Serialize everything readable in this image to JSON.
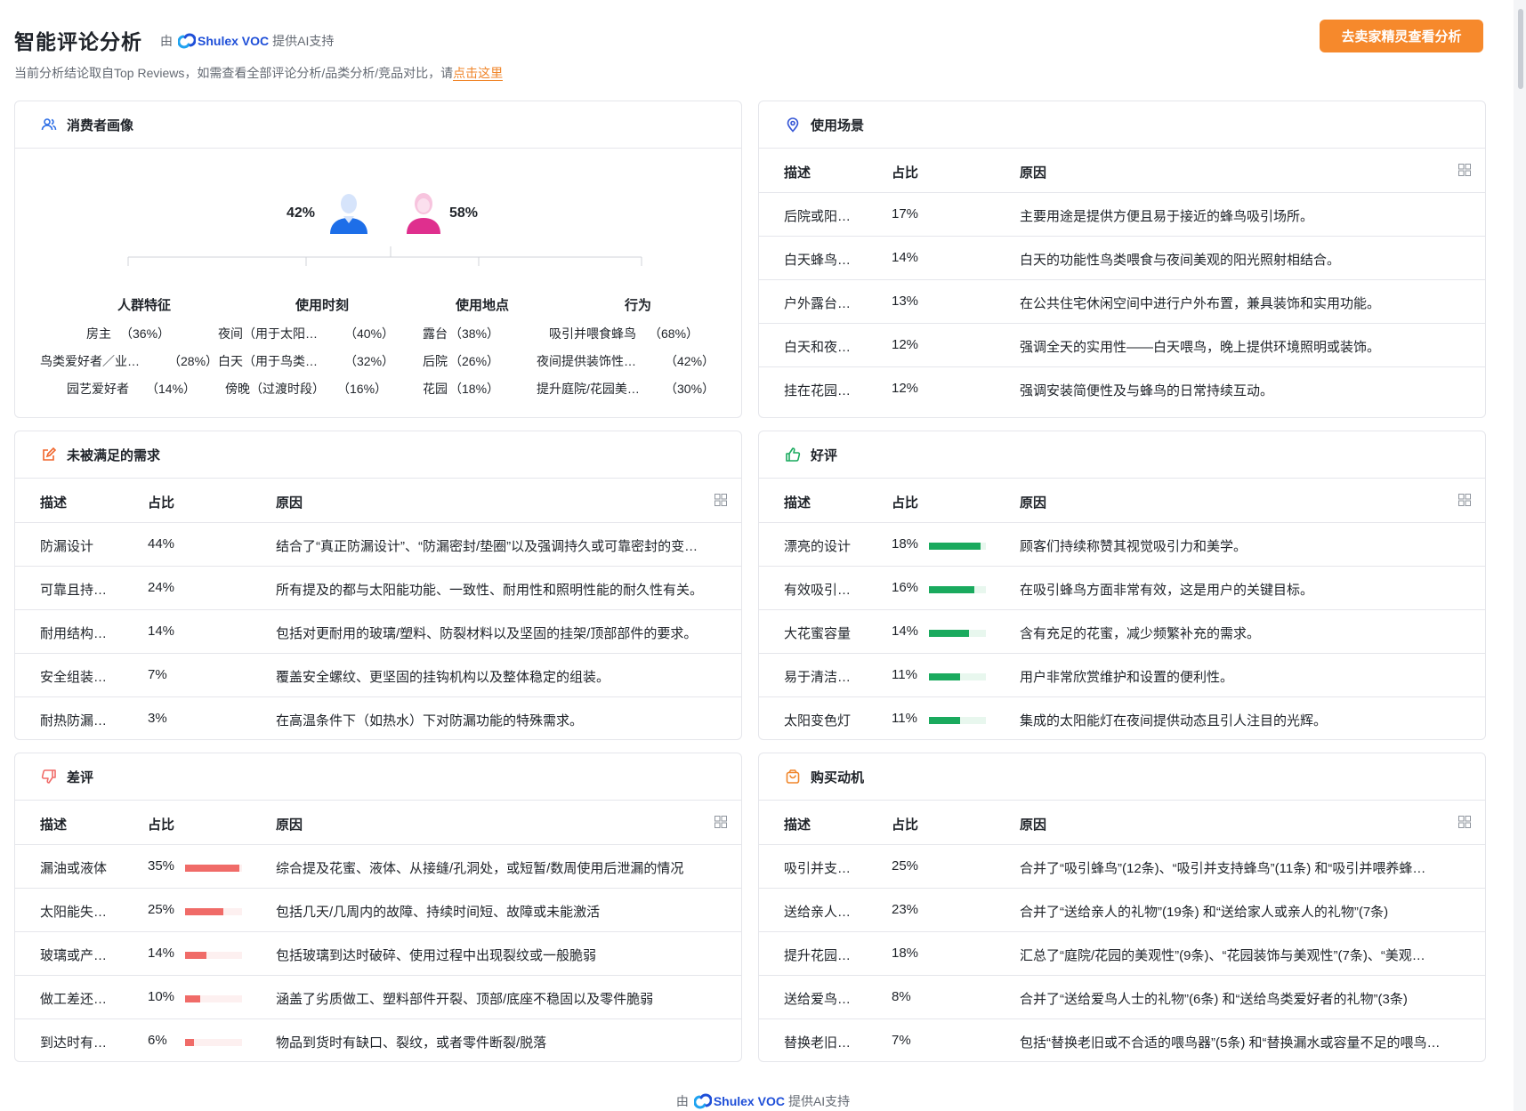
{
  "header": {
    "title": "智能评论分析",
    "powered_prefix": "由",
    "brand": "Shulex VOC",
    "powered_suffix": "提供AI支持",
    "note": "当前分析结论取自Top Reviews，如需查看全部评论分析/品类分析/竞品对比，请",
    "note_link": "点击这里",
    "cta": "去卖家精灵查看分析"
  },
  "persona": {
    "title": "消费者画像",
    "male_pct": "42%",
    "female_pct": "58%",
    "categories": [
      {
        "title": "人群特征",
        "items": [
          {
            "label": "房主",
            "pct": "（36%）"
          },
          {
            "label": "鸟类爱好者／业…",
            "pct": "（28%）"
          },
          {
            "label": "园艺爱好者",
            "pct": "（14%）"
          }
        ]
      },
      {
        "title": "使用时刻",
        "items": [
          {
            "label": "夜间（用于太阳…",
            "pct": "（40%）"
          },
          {
            "label": "白天（用于鸟类…",
            "pct": "（32%）"
          },
          {
            "label": "傍晚（过渡时段）",
            "pct": "（16%）"
          }
        ]
      },
      {
        "title": "使用地点",
        "items": [
          {
            "label": "露台",
            "pct": "（38%）"
          },
          {
            "label": "后院",
            "pct": "（26%）"
          },
          {
            "label": "花园",
            "pct": "（18%）"
          }
        ]
      },
      {
        "title": "行为",
        "items": [
          {
            "label": "吸引并喂食蜂鸟",
            "pct": "（68%）"
          },
          {
            "label": "夜间提供装饰性…",
            "pct": "（42%）"
          },
          {
            "label": "提升庭院/花园美…",
            "pct": "（30%）"
          }
        ]
      }
    ]
  },
  "columns": {
    "desc": "描述",
    "pct": "占比",
    "reason": "原因"
  },
  "scenes": {
    "title": "使用场景",
    "rows": [
      {
        "desc": "后院或阳…",
        "pct": "17%",
        "reason": "主要用途是提供方便且易于接近的蜂鸟吸引场所。"
      },
      {
        "desc": "白天蜂鸟…",
        "pct": "14%",
        "reason": "白天的功能性鸟类喂食与夜间美观的阳光照射相结合。"
      },
      {
        "desc": "户外露台…",
        "pct": "13%",
        "reason": "在公共住宅休闲空间中进行户外布置，兼具装饰和实用功能。"
      },
      {
        "desc": "白天和夜…",
        "pct": "12%",
        "reason": "强调全天的实用性——白天喂鸟，晚上提供环境照明或装饰。"
      },
      {
        "desc": "挂在花园…",
        "pct": "12%",
        "reason": "强调安装简便性及与蜂鸟的日常持续互动。"
      }
    ]
  },
  "unmet": {
    "title": "未被满足的需求",
    "rows": [
      {
        "desc": "防漏设计",
        "pct": "44%",
        "reason": "结合了“真正防漏设计”、“防漏密封/垫圈”以及强调持久或可靠密封的变…"
      },
      {
        "desc": "可靠且持…",
        "pct": "24%",
        "reason": "所有提及的都与太阳能功能、一致性、耐用性和照明性能的耐久性有关。"
      },
      {
        "desc": "耐用结构…",
        "pct": "14%",
        "reason": "包括对更耐用的玻璃/塑料、防裂材料以及坚固的挂架/顶部部件的要求。"
      },
      {
        "desc": "安全组装…",
        "pct": "7%",
        "reason": "覆盖安全螺纹、更坚固的挂钩机构以及整体稳定的组装。"
      },
      {
        "desc": "耐热防漏…",
        "pct": "3%",
        "reason": "在高温条件下（如热水）下对防漏功能的特殊需求。"
      }
    ]
  },
  "positive": {
    "title": "好评",
    "bar_color": "#1aaa5e",
    "rows": [
      {
        "desc": "漂亮的设计",
        "pct": "18%",
        "value": 0.18,
        "reason": "顾客们持续称赞其视觉吸引力和美学。"
      },
      {
        "desc": "有效吸引…",
        "pct": "16%",
        "value": 0.16,
        "reason": "在吸引蜂鸟方面非常有效，这是用户的关键目标。"
      },
      {
        "desc": "大花蜜容量",
        "pct": "14%",
        "value": 0.14,
        "reason": "含有充足的花蜜，减少频繁补充的需求。"
      },
      {
        "desc": "易于清洁…",
        "pct": "11%",
        "value": 0.11,
        "reason": "用户非常欣赏维护和设置的便利性。"
      },
      {
        "desc": "太阳变色灯",
        "pct": "11%",
        "value": 0.11,
        "reason": "集成的太阳能灯在夜间提供动态且引人注目的光辉。"
      }
    ]
  },
  "negative": {
    "title": "差评",
    "bar_color": "#f06b68",
    "rows": [
      {
        "desc": "漏油或液体",
        "pct": "35%",
        "value": 0.35,
        "reason": "综合提及花蜜、液体、从接缝/孔洞处，或短暂/数周使用后泄漏的情况"
      },
      {
        "desc": "太阳能失…",
        "pct": "25%",
        "value": 0.25,
        "reason": "包括几天/几周内的故障、持续时间短、故障或未能激活"
      },
      {
        "desc": "玻璃或产…",
        "pct": "14%",
        "value": 0.14,
        "reason": "包括玻璃到达时破碎、使用过程中出现裂纹或一般脆弱"
      },
      {
        "desc": "做工差还…",
        "pct": "10%",
        "value": 0.1,
        "reason": "涵盖了劣质做工、塑料部件开裂、顶部/底座不稳固以及零件脆弱"
      },
      {
        "desc": "到达时有…",
        "pct": "6%",
        "value": 0.06,
        "reason": "物品到货时有缺口、裂纹，或者零件断裂/脱落"
      }
    ]
  },
  "motive": {
    "title": "购买动机",
    "rows": [
      {
        "desc": "吸引并支…",
        "pct": "25%",
        "reason": "合并了“吸引蜂鸟”(12条)、“吸引并支持蜂鸟”(11条) 和“吸引并喂养蜂…"
      },
      {
        "desc": "送给亲人…",
        "pct": "23%",
        "reason": "合并了“送给亲人的礼物”(19条) 和“送给家人或亲人的礼物”(7条)"
      },
      {
        "desc": "提升花园…",
        "pct": "18%",
        "reason": "汇总了“庭院/花园的美观性”(9条)、“花园装饰与美观性”(7条)、“美观…"
      },
      {
        "desc": "送给爱鸟…",
        "pct": "8%",
        "reason": "合并了“送给爱鸟人士的礼物”(6条) 和“送给鸟类爱好者的礼物”(3条)"
      },
      {
        "desc": "替换老旧…",
        "pct": "7%",
        "reason": "包括“替换老旧或不合适的喂鸟器”(5条) 和“替换漏水或容量不足的喂鸟…"
      }
    ]
  },
  "footer": {
    "prefix": "由",
    "brand": "Shulex VOC",
    "suffix": "提供AI支持"
  }
}
